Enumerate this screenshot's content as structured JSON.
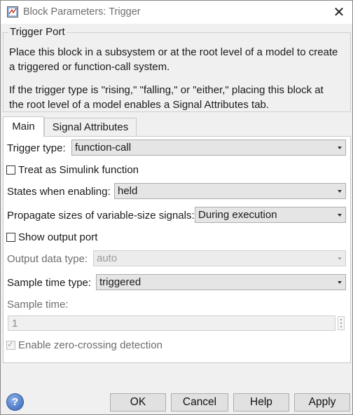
{
  "window": {
    "title": "Block Parameters: Trigger",
    "close_glyph": "✕"
  },
  "group": {
    "title": "Trigger Port",
    "description": [
      "Place this block in a subsystem or at the root level of a model to create",
      "a triggered or function-call system.",
      "If the trigger type is \"rising,\" \"falling,\" or \"either,\" placing this block at",
      "the root level of a model enables a Signal Attributes tab."
    ]
  },
  "tabs": [
    {
      "label": "Main",
      "active": true
    },
    {
      "label": "Signal Attributes",
      "active": false
    }
  ],
  "main": {
    "trigger_type": {
      "label": "Trigger type:",
      "value": "function-call"
    },
    "treat_as_simulink_function": {
      "label": "Treat as Simulink function",
      "checked": false
    },
    "states_when_enabling": {
      "label": "States when enabling:",
      "value": "held"
    },
    "propagate_sizes": {
      "label": "Propagate sizes of variable-size signals:",
      "value": "During execution"
    },
    "show_output_port": {
      "label": "Show output port",
      "checked": false
    },
    "output_data_type": {
      "label": "Output data type:",
      "value": "auto",
      "enabled": false
    },
    "sample_time_type": {
      "label": "Sample time type:",
      "value": "triggered"
    },
    "sample_time": {
      "label": "Sample time:",
      "value": "1",
      "enabled": false
    },
    "zero_crossing": {
      "label": "Enable zero-crossing detection",
      "checked": true,
      "enabled": false
    }
  },
  "buttons": {
    "help_icon": "?",
    "ok": "OK",
    "cancel": "Cancel",
    "help": "Help",
    "apply": "Apply"
  },
  "icons": {
    "app": "simulink-block-icon",
    "help": "question-mark-icon",
    "close": "close-icon",
    "dropdown": "chevron-down-icon"
  },
  "colors": {
    "window_bg": "#f0f0f0",
    "panel_bg": "#ffffff",
    "help_blue": "#2f5fb5"
  }
}
